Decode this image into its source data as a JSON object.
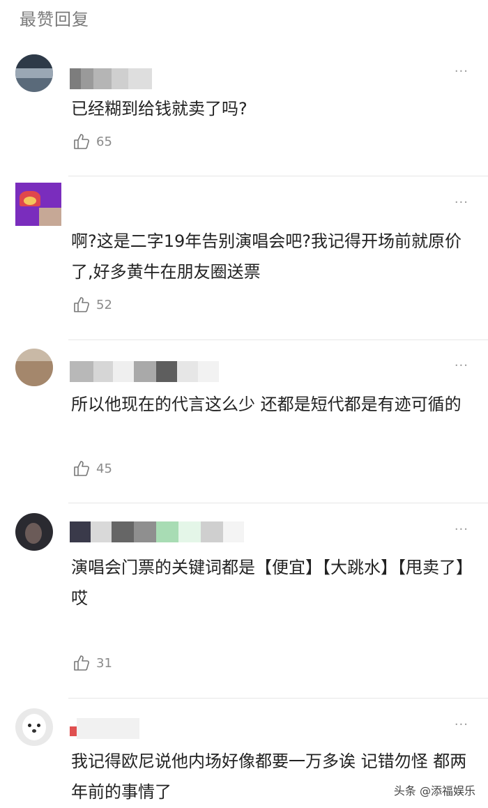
{
  "section_title": "最赞回复",
  "more_icon": "···",
  "comments": [
    {
      "text": "已经糊到给钱就卖了吗?",
      "likes": "65"
    },
    {
      "text": "啊?这是二字19年告别演唱会吧?我记得开场前就原价了,好多黄牛在朋友圈送票",
      "likes": "52"
    },
    {
      "text": "所以他现在的代言这么少 还都是短代都是有迹可循的",
      "likes": "45"
    },
    {
      "text": "演唱会门票的关键词都是【便宜】【大跳水】【甩卖了】哎",
      "likes": "31"
    },
    {
      "text": "我记得欧尼说他内场好像都要一万多诶 记错勿怪 都两年前的事情了"
    }
  ],
  "watermark": "头条 @添福娱乐"
}
